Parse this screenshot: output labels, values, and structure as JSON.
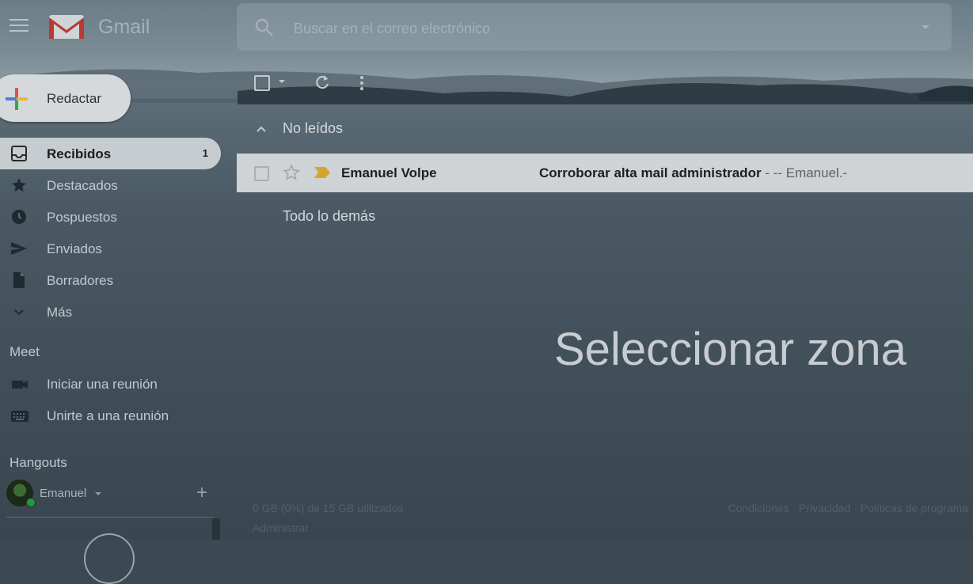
{
  "app": {
    "name": "Gmail"
  },
  "search": {
    "placeholder": "Buscar en el correo electrónico"
  },
  "compose": {
    "label": "Redactar"
  },
  "nav": {
    "items": [
      {
        "label": "Recibidos",
        "count": "1",
        "icon": "inbox-icon"
      },
      {
        "label": "Destacados",
        "icon": "star-icon"
      },
      {
        "label": "Pospuestos",
        "icon": "clock-icon"
      },
      {
        "label": "Enviados",
        "icon": "send-icon"
      },
      {
        "label": "Borradores",
        "icon": "draft-icon"
      },
      {
        "label": "Más",
        "icon": "chevron-down-icon"
      }
    ]
  },
  "meet": {
    "title": "Meet",
    "items": [
      {
        "label": "Iniciar una reunión",
        "icon": "video-icon"
      },
      {
        "label": "Unirte a una reunión",
        "icon": "keyboard-icon"
      }
    ]
  },
  "hangouts": {
    "title": "Hangouts",
    "user": "Emanuel"
  },
  "sections": {
    "unread": "No leídos",
    "everything_else": "Todo lo demás"
  },
  "emails": [
    {
      "sender": "Emanuel Volpe",
      "subject": "Corroborar alta mail administrador",
      "snippet": " - -- Emanuel.-"
    }
  ],
  "overlay": {
    "text": "Seleccionar zona"
  },
  "footer": {
    "storage": "0 GB (0%) de 15 GB utilizados",
    "manage": "Administrar",
    "links": "Condiciones · Privacidad · Políticas de programa"
  },
  "colors": {
    "active_bg": "#c7ccd0",
    "important": "#d4a52a",
    "online": "#1f9c39"
  }
}
